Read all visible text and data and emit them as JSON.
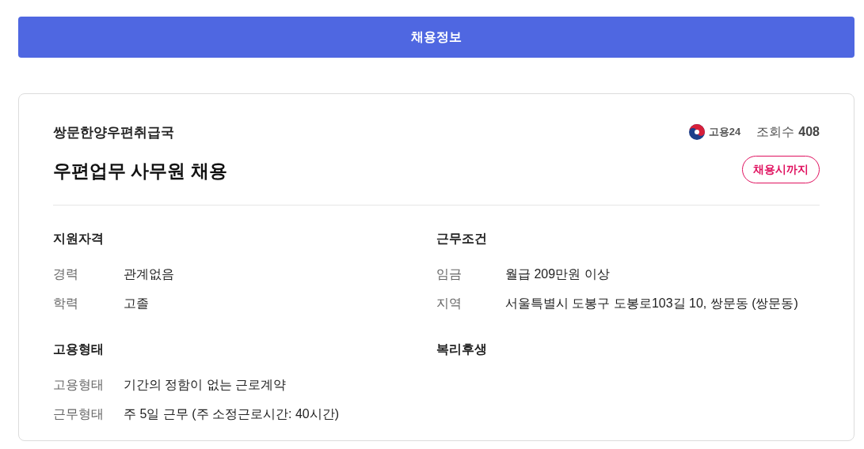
{
  "header": {
    "title": "채용정보"
  },
  "job": {
    "company": "쌍문한양우편취급국",
    "title": "우편업무 사무원 채용",
    "source": "고용24",
    "views_label": "조회수",
    "views": "408",
    "deadline": "채용시까지"
  },
  "sections": [
    {
      "title": "지원자격",
      "rows": [
        {
          "label": "경력",
          "value": "관계없음"
        },
        {
          "label": "학력",
          "value": "고졸"
        }
      ]
    },
    {
      "title": "근무조건",
      "rows": [
        {
          "label": "임금",
          "value": "월급 209만원 이상"
        },
        {
          "label": "지역",
          "value": "서울특별시 도봉구 도봉로103길 10, 쌍문동 (쌍문동)"
        }
      ]
    },
    {
      "title": "고용형태",
      "rows": [
        {
          "label": "고용형태",
          "value": "기간의 정함이 없는 근로계약"
        },
        {
          "label": "근무형태",
          "value": "주 5일 근무 (주 소정근로시간: 40시간)"
        }
      ]
    },
    {
      "title": "복리후생"
    }
  ]
}
